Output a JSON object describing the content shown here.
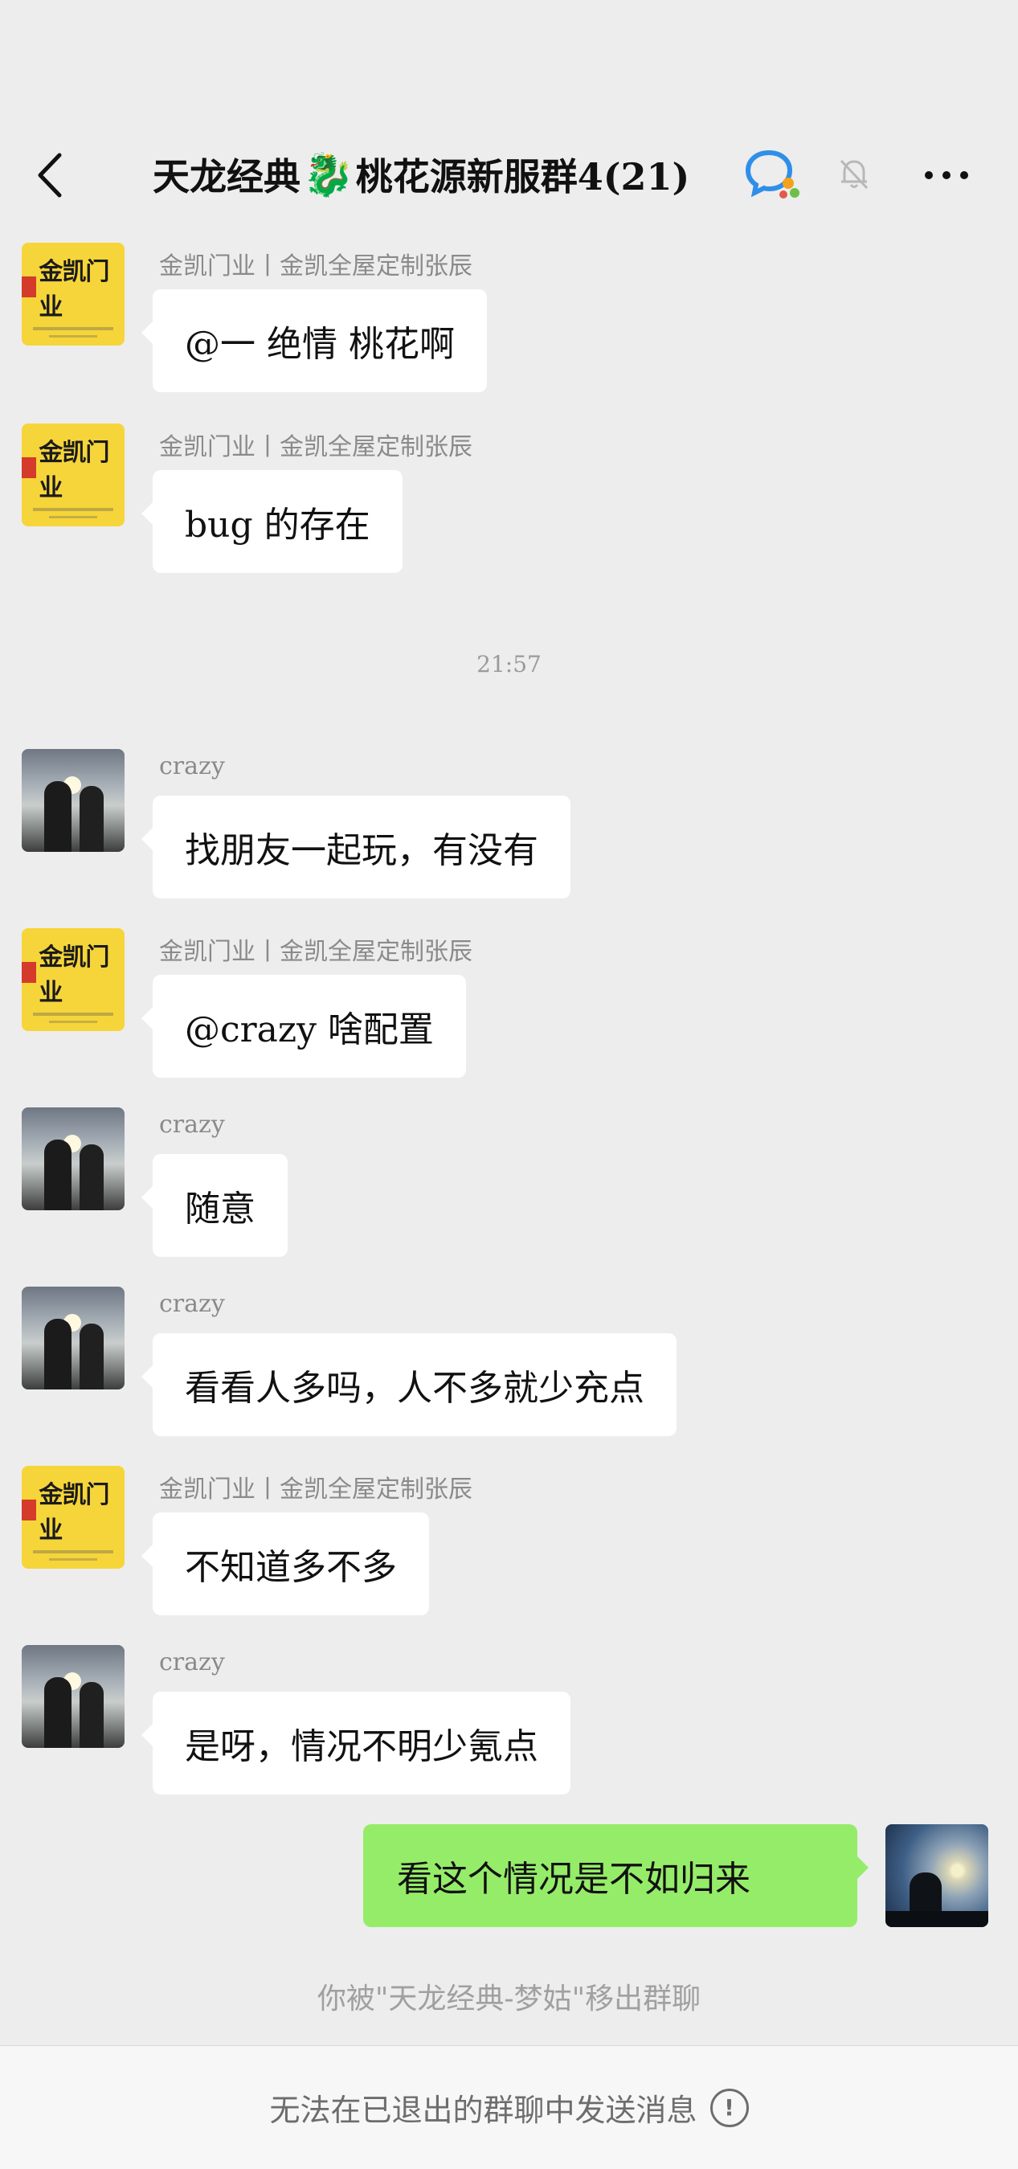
{
  "header": {
    "title_part1": "天龙经典",
    "title_emoji": "🐉",
    "title_part2": "桃花源新服群4(21)",
    "icons": [
      "back-icon",
      "chat-bubble-icon",
      "mute-bell-icon",
      "more-icon"
    ]
  },
  "messages": [
    {
      "sender": "金凯门业丨金凯全屋定制张辰",
      "text": "@一  绝情 桃花啊",
      "avatar": "brand"
    },
    {
      "sender": "金凯门业丨金凯全屋定制张辰",
      "text": "bug 的存在",
      "avatar": "brand"
    },
    {
      "sender": "crazy",
      "text": "找朋友一起玩，有没有",
      "avatar": "photo"
    },
    {
      "sender": "金凯门业丨金凯全屋定制张辰",
      "text": "@crazy 啥配置",
      "avatar": "brand"
    },
    {
      "sender": "crazy",
      "text": "随意",
      "avatar": "photo"
    },
    {
      "sender": "crazy",
      "text": "看看人多吗，人不多就少充点",
      "avatar": "photo"
    },
    {
      "sender": "金凯门业丨金凯全屋定制张辰",
      "text": "不知道多不多",
      "avatar": "brand"
    },
    {
      "sender": "crazy",
      "text": "是呀，情况不明少氪点",
      "avatar": "photo"
    }
  ],
  "brand_logo_text": "金凯门业",
  "timestamp": "21:57",
  "my_message": "看这个情况是不如归来",
  "system_note": "你被\"天龙经典-梦姑\"移出群聊",
  "footer": {
    "text": "无法在已退出的群聊中发送消息",
    "icon": "alert-circle-icon"
  },
  "colors": {
    "background": "#ededed",
    "my_bubble": "#95ec69",
    "other_bubble": "#ffffff",
    "brand_avatar": "#f6d53a"
  }
}
